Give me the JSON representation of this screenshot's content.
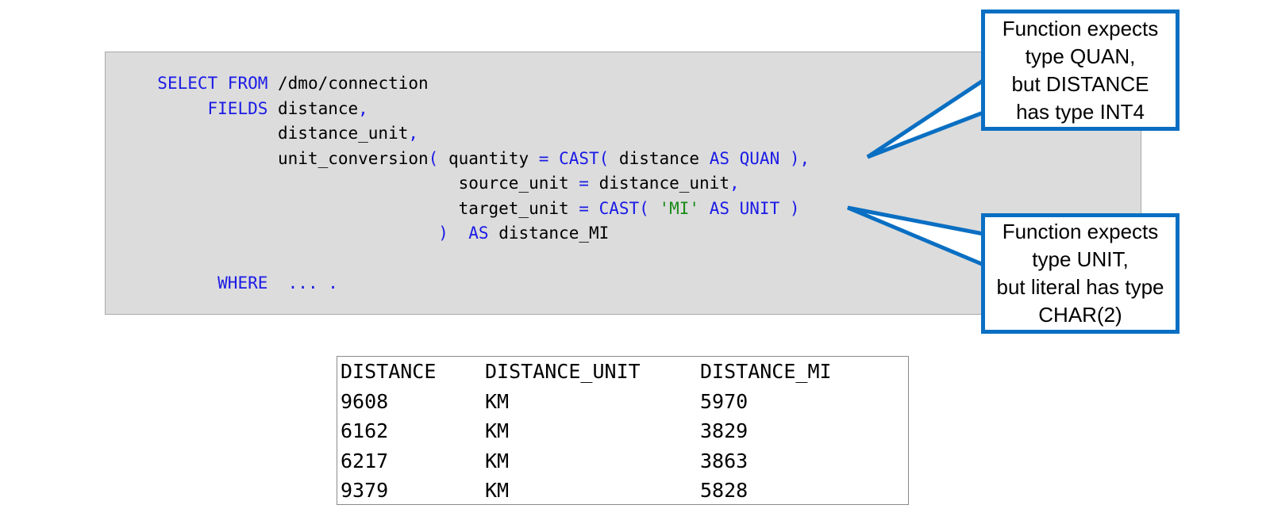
{
  "code": {
    "lines": [
      [
        {
          "t": "  "
        },
        {
          "t": "SELECT FROM",
          "k": "kw"
        },
        {
          "t": " /dmo/connection"
        }
      ],
      [
        {
          "t": "       "
        },
        {
          "t": "FIELDS",
          "k": "kw"
        },
        {
          "t": " distance"
        },
        {
          "t": ",",
          "k": "kw"
        }
      ],
      [
        {
          "t": "              distance_unit"
        },
        {
          "t": ",",
          "k": "kw"
        }
      ],
      [
        {
          "t": "              unit_conversion"
        },
        {
          "t": "(",
          "k": "kw"
        },
        {
          "t": " quantity "
        },
        {
          "t": "=",
          "k": "kw"
        },
        {
          "t": " "
        },
        {
          "t": "CAST(",
          "k": "kw"
        },
        {
          "t": " distance "
        },
        {
          "t": "AS QUAN",
          "k": "kw"
        },
        {
          "t": " "
        },
        {
          "t": "),",
          "k": "kw"
        }
      ],
      [
        {
          "t": "                                source_unit "
        },
        {
          "t": "=",
          "k": "kw"
        },
        {
          "t": " distance_unit"
        },
        {
          "t": ",",
          "k": "kw"
        }
      ],
      [
        {
          "t": "                                target_unit "
        },
        {
          "t": "=",
          "k": "kw"
        },
        {
          "t": " "
        },
        {
          "t": "CAST(",
          "k": "kw"
        },
        {
          "t": " "
        },
        {
          "t": "'MI'",
          "k": "str"
        },
        {
          "t": " "
        },
        {
          "t": "AS UNIT",
          "k": "kw"
        },
        {
          "t": " "
        },
        {
          "t": ")",
          "k": "kw"
        }
      ],
      [
        {
          "t": "                              "
        },
        {
          "t": ")",
          "k": "kw"
        },
        {
          "t": "  "
        },
        {
          "t": "AS",
          "k": "kw"
        },
        {
          "t": " distance_MI"
        }
      ],
      [
        {
          "t": ""
        }
      ],
      [
        {
          "t": "        "
        },
        {
          "t": "WHERE  ... .",
          "k": "kw"
        }
      ]
    ]
  },
  "callouts": [
    {
      "lines": [
        "Function expects",
        "type QUAN,",
        "but DISTANCE",
        "has type INT4"
      ]
    },
    {
      "lines": [
        "Function expects",
        "type UNIT,",
        "but literal has type",
        "CHAR(2)"
      ]
    }
  ],
  "result": {
    "headers": [
      "DISTANCE",
      "DISTANCE_UNIT",
      "DISTANCE_MI"
    ],
    "rows": [
      [
        "9608",
        "KM",
        "5970"
      ],
      [
        "6162",
        "KM",
        "3829"
      ],
      [
        "6217",
        "KM",
        "3863"
      ],
      [
        "9379",
        "KM",
        "5828"
      ]
    ]
  },
  "colors": {
    "keyword": "#1a1ae6",
    "string": "#1a8a1a",
    "callout_border": "#0a6fc2",
    "code_background": "#dcdcdc"
  }
}
